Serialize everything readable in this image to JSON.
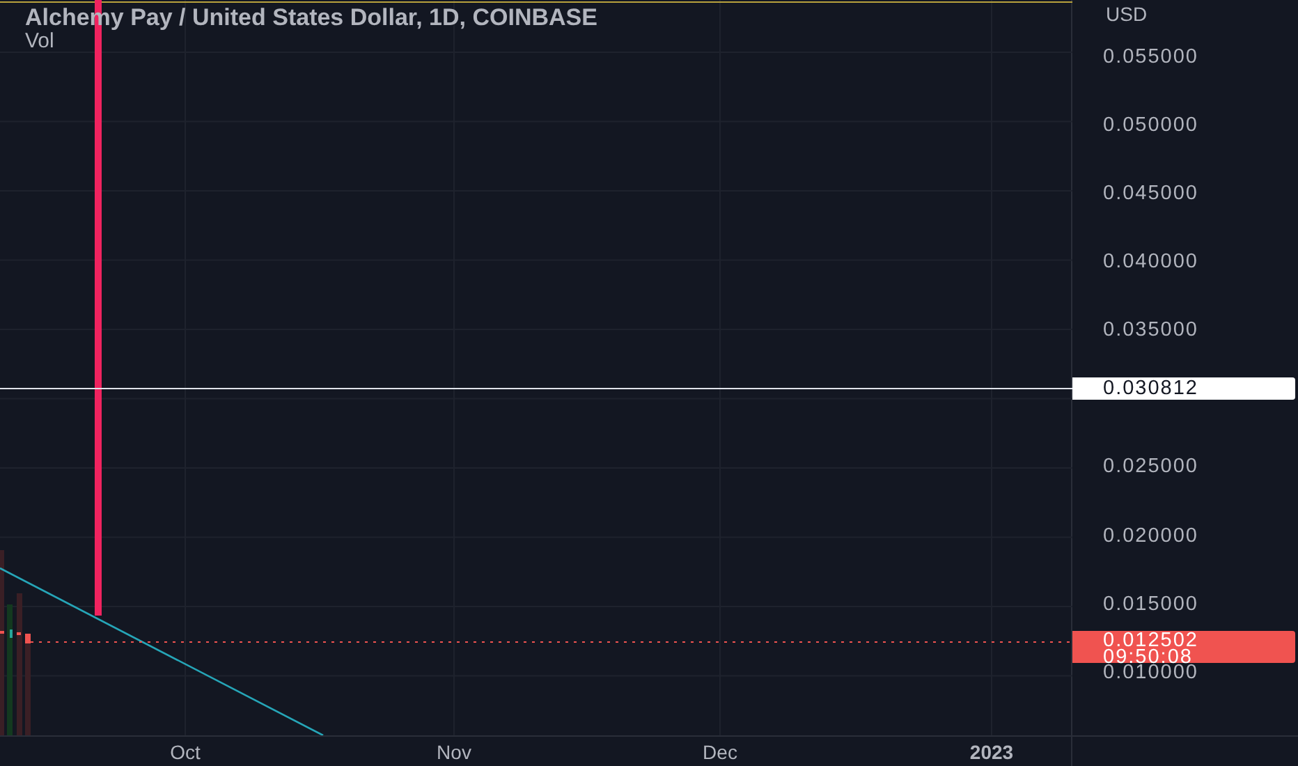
{
  "legend": {
    "title": "Alchemy Pay / United States Dollar, 1D, COINBASE",
    "indicator": "Vol"
  },
  "price_axis": {
    "currency": "USD",
    "upper_ticks": [
      "0.055000",
      "0.050000",
      "0.045000",
      "0.040000",
      "0.035000"
    ],
    "lower_ticks": [
      "0.025000",
      "0.020000",
      "0.015000",
      "0.010000"
    ]
  },
  "price_tags": [
    {
      "kind": "crosshair",
      "value": "0.030812"
    },
    {
      "kind": "last",
      "value": "0.012502",
      "countdown": "09:50:08"
    }
  ],
  "time_axis": [
    {
      "label": "Oct",
      "kind": "month"
    },
    {
      "label": "Nov",
      "kind": "month"
    },
    {
      "label": "Dec",
      "kind": "month"
    },
    {
      "label": "2023",
      "kind": "year"
    }
  ]
}
